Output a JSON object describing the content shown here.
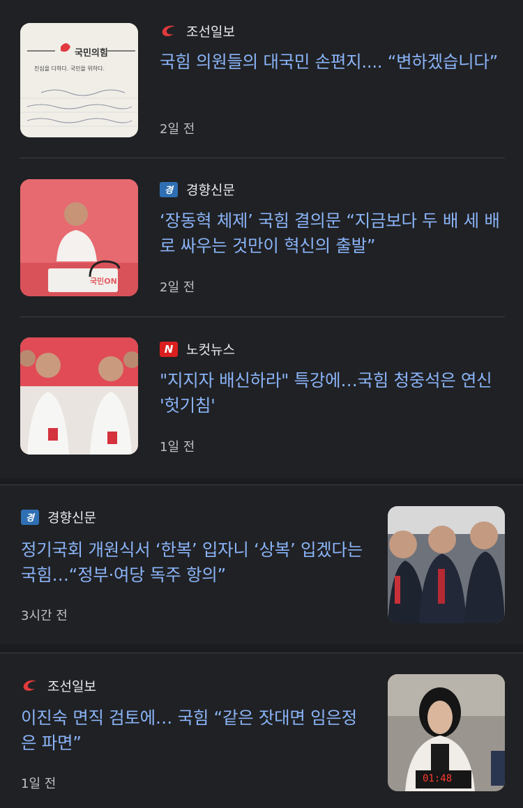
{
  "articles": [
    {
      "source": "조선일보",
      "source_logo": "chosun-logo",
      "headline": "국힘 의원들의 대국민 손편지.... “변하겠습니다”",
      "time": "2일 전",
      "thumb_text": "국민의힘",
      "thumb_subtext": "진심을 다하다. 국민을 위하다."
    },
    {
      "source": "경향신문",
      "source_logo": "kyunghyang-logo",
      "headline": "‘장동혁 체제’ 국힘 결의문 “지금보다 두 배 세 배로 싸우는 것만이 혁신의 출발”",
      "time": "2일 전",
      "thumb_text": "국민ON"
    },
    {
      "source": "노컷뉴스",
      "source_logo": "nocut-logo",
      "headline": "\"지지자 배신하라\" 특강에…국힘 청중석은 연신 '헛기침'",
      "time": "1일 전"
    },
    {
      "source": "경향신문",
      "source_logo": "kyunghyang-logo",
      "headline": "정기국회 개원식서 ‘한복’ 입자니 ‘상복’ 입겠다는 국힘…“정부·여당 독주 항의”",
      "time": "3시간 전"
    },
    {
      "source": "조선일보",
      "source_logo": "chosun-logo",
      "headline": "이진숙 면직 검토에… 국힘 “같은 잣대면 임은정은 파면”",
      "time": "1일 전",
      "thumb_text": "01:48"
    }
  ],
  "logos": {
    "kh_mark": "경",
    "nocut_mark": "N"
  },
  "colors": {
    "background": "#202124",
    "headline": "#8ab4f8",
    "meta": "#bdc1c6",
    "brand_red": "#e03a3e"
  }
}
